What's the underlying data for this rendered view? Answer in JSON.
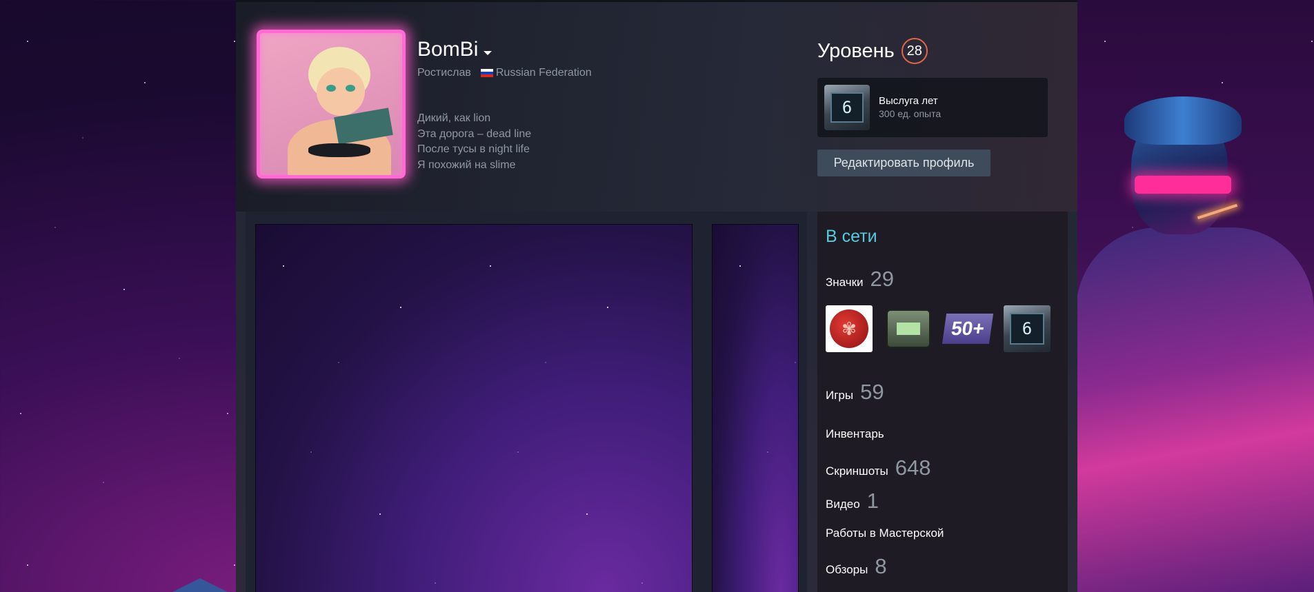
{
  "profile": {
    "username": "BomBi",
    "real_name": "Ростислав",
    "country": "Russian Federation",
    "summary": [
      "Дикий, как lion",
      "Эта дорога – dead line",
      "После тусы в night life",
      "Я похожий на slime"
    ]
  },
  "level": {
    "label": "Уровень",
    "value": "28"
  },
  "featured_badge": {
    "icon_text": "6",
    "title": "Выслуга лет",
    "xp": "300 ед. опыта"
  },
  "actions": {
    "edit_profile": "Редактировать профиль"
  },
  "sidebar": {
    "status": "В сети",
    "badges_label": "Значки",
    "badges_count": "29",
    "badge_tag_text": "50+",
    "badge_years_text": "6",
    "games_label": "Игры",
    "games_count": "59",
    "inventory_label": "Инвентарь",
    "screenshots_label": "Скриншоты",
    "screenshots_count": "648",
    "videos_label": "Видео",
    "videos_count": "1",
    "workshop_label": "Работы в Мастерской",
    "reviews_label": "Обзоры",
    "reviews_count": "8"
  },
  "colors": {
    "online": "#57cbde",
    "level_ring": "#e2674a",
    "avatar_frame": "#ff6ad5"
  }
}
